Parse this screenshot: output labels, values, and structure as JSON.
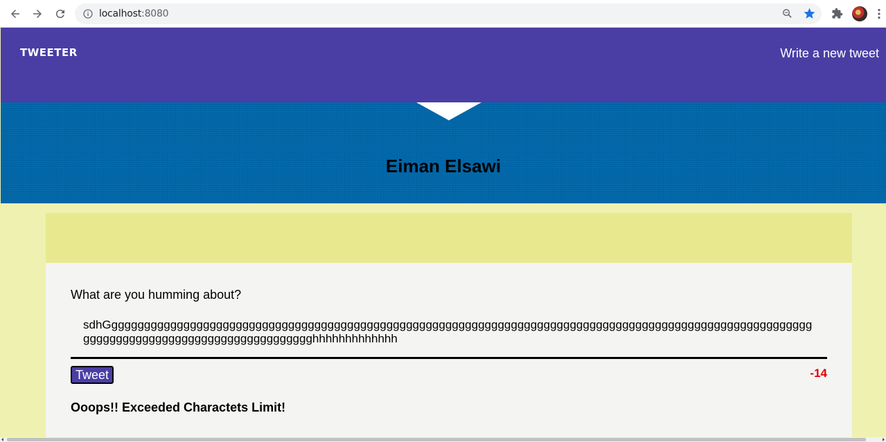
{
  "browser": {
    "url_host": "localhost",
    "url_port": ":8080",
    "icons": [
      "back-icon",
      "forward-icon",
      "reload-icon",
      "info-icon",
      "zoom-icon",
      "star-icon",
      "extensions-icon",
      "avatar",
      "menu-icon"
    ]
  },
  "header": {
    "brand": "TWEETER",
    "write_link": "Write a new tweet"
  },
  "profile": {
    "name": "Eiman Elsawi"
  },
  "compose": {
    "label": "What are you humming about?",
    "text": "sdhGgggggggggggggggggggggggggggggggggggggggggggggggggggggggggggggggggggggggggggggggggggggggggggggggggggggggggggggggggggggggggggggggggggggggggggggghhhhhhhhhhhhh",
    "button_label": "Tweet",
    "counter": "-14",
    "error": "Ooops!! Exceeded Charactets Limit!"
  },
  "colors": {
    "nav": "#4a3ea5",
    "banner": "#0066a8",
    "page_bg": "#eef1b0",
    "container_top": "#e8e98f",
    "counter_error": "#e00000"
  }
}
